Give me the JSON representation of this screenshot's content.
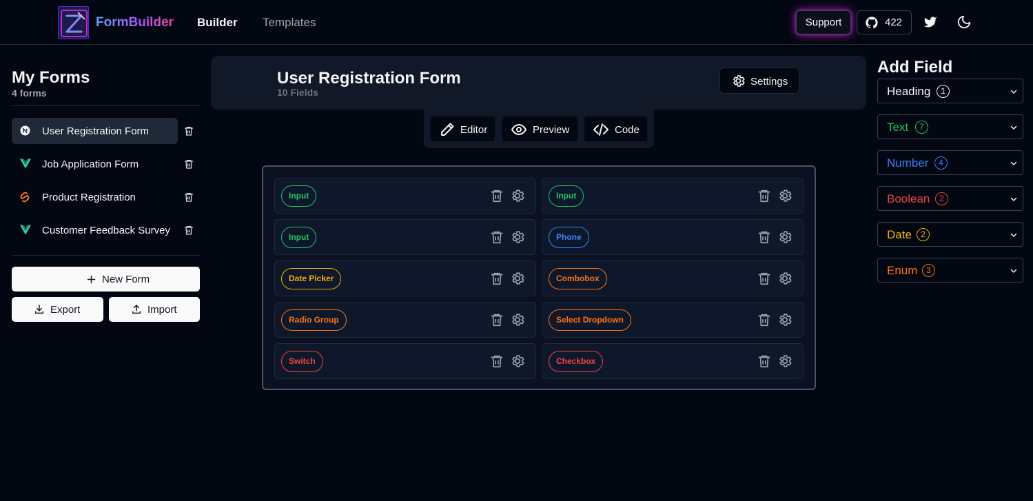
{
  "header": {
    "brand": "FormBuilder",
    "nav": [
      "Builder",
      "Templates"
    ],
    "support_label": "Support",
    "github_stars": "422"
  },
  "sidebar": {
    "title": "My Forms",
    "subtitle": "4 forms",
    "forms": [
      {
        "label": "User Registration Form",
        "icon": "nextjs-icon",
        "active": true
      },
      {
        "label": "Job Application Form",
        "icon": "vue-icon",
        "active": false
      },
      {
        "label": "Product Registration",
        "icon": "svelte-icon",
        "active": false
      },
      {
        "label": "Customer Feedback Survey",
        "icon": "vue-icon",
        "active": false
      }
    ],
    "new_form_label": "New Form",
    "export_label": "Export",
    "import_label": "Import"
  },
  "form": {
    "title": "User Registration Form",
    "field_count": "10 Fields",
    "settings_label": "Settings",
    "tabs": [
      "Editor",
      "Preview",
      "Code"
    ],
    "fields": [
      {
        "label": "Input",
        "color": "#22c55e"
      },
      {
        "label": "Input",
        "color": "#22c55e"
      },
      {
        "label": "Input",
        "color": "#22c55e"
      },
      {
        "label": "Phone",
        "color": "#3b82f6"
      },
      {
        "label": "Date Picker",
        "color": "#eab308"
      },
      {
        "label": "Combobox",
        "color": "#f97316"
      },
      {
        "label": "Radio Group",
        "color": "#f97316"
      },
      {
        "label": "Select Dropdown",
        "color": "#f97316"
      },
      {
        "label": "Switch",
        "color": "#ef4444"
      },
      {
        "label": "Checkbox",
        "color": "#ef4444"
      }
    ]
  },
  "add_field": {
    "title": "Add Field",
    "categories": [
      {
        "label": "Heading",
        "count": "1",
        "color": "#f3f4f6"
      },
      {
        "label": "Text",
        "count": "7",
        "color": "#22c55e"
      },
      {
        "label": "Number",
        "count": "4",
        "color": "#3b82f6"
      },
      {
        "label": "Boolean",
        "count": "2",
        "color": "#ef4444"
      },
      {
        "label": "Date",
        "count": "2",
        "color": "#eab308"
      },
      {
        "label": "Enum",
        "count": "3",
        "color": "#f97316"
      }
    ]
  }
}
